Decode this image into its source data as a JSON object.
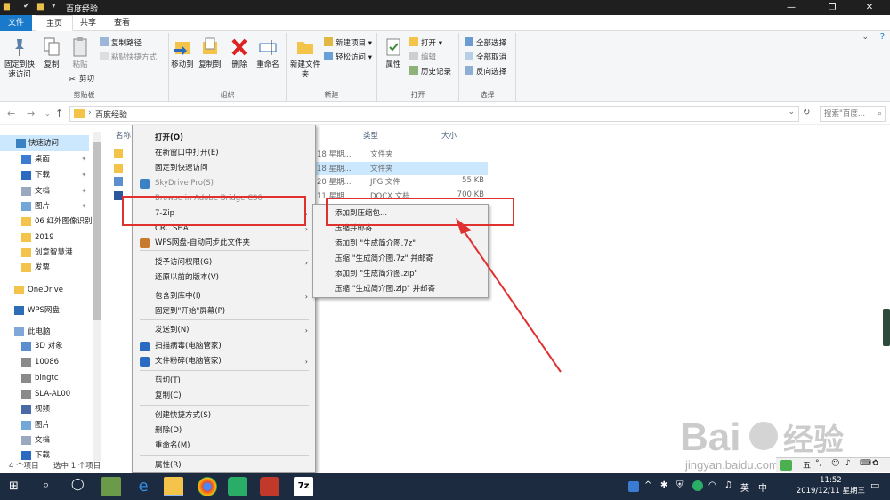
{
  "window": {
    "title": "百度经验"
  },
  "tabs": {
    "file": "文件",
    "home": "主页",
    "share": "共享",
    "view": "查看"
  },
  "ribbon": {
    "pin_label": "固定到快速访问",
    "copy_label": "复制",
    "paste_label": "粘贴",
    "copy_path": "复制路径",
    "paste_shortcut": "粘贴快捷方式",
    "cut": "剪切",
    "clipboard_group": "剪贴板",
    "move_to": "移动到",
    "copy_to": "复制到",
    "delete": "删除",
    "rename": "重命名",
    "organize_group": "组织",
    "new_folder": "新建文件夹",
    "new_item": "新建项目",
    "easy_access": "轻松访问",
    "new_group": "新建",
    "properties": "属性",
    "open": "打开",
    "edit": "编辑",
    "history": "历史记录",
    "open_group": "打开",
    "select_all": "全部选择",
    "select_none": "全部取消",
    "invert_select": "反向选择",
    "select_group": "选择"
  },
  "address": {
    "path": "百度经验",
    "search_placeholder": "搜索\"百度..."
  },
  "nav": {
    "items": [
      {
        "label": "快速访问"
      },
      {
        "label": "桌面"
      },
      {
        "label": "下载"
      },
      {
        "label": "文档"
      },
      {
        "label": "图片"
      },
      {
        "label": "06 红外图像识别"
      },
      {
        "label": "2019"
      },
      {
        "label": "创意智慧港"
      },
      {
        "label": "发票"
      },
      {
        "label": "OneDrive"
      },
      {
        "label": "WPS网盘"
      },
      {
        "label": "此电脑"
      },
      {
        "label": "3D 对象"
      },
      {
        "label": "10086"
      },
      {
        "label": "bingtc"
      },
      {
        "label": "SLA-AL00"
      },
      {
        "label": "视频"
      },
      {
        "label": "图片"
      },
      {
        "label": "文档"
      },
      {
        "label": "下载"
      }
    ]
  },
  "filelist": {
    "headers": {
      "name": "名称",
      "type": "类型",
      "size": "大小"
    },
    "rows": [
      {
        "date": "18 星期...",
        "type": "文件夹",
        "size": ""
      },
      {
        "date": "18 星期...",
        "type": "文件夹",
        "size": ""
      },
      {
        "date": "20 星期...",
        "type": "JPG 文件",
        "size": "55 KB"
      },
      {
        "date": "11 星期...",
        "type": "DOCX 文档",
        "size": "700 KB"
      }
    ]
  },
  "status": {
    "count": "4 个项目",
    "selected": "选中 1 个项目"
  },
  "context_menu": {
    "items": [
      "打开(O)",
      "在新窗口中打开(E)",
      "固定到快速访问",
      "SkyDrive Pro(S)",
      "Browse in Adobe Bridge CS6",
      "7-Zip",
      "CRC SHA",
      "WPS网盘-自动同步此文件夹",
      "授予访问权限(G)",
      "还原以前的版本(V)",
      "包含到库中(I)",
      "固定到\"开始\"屏幕(P)",
      "发送到(N)",
      "扫描病毒(电脑管家)",
      "文件粉碎(电脑管家)",
      "剪切(T)",
      "复制(C)",
      "创建快捷方式(S)",
      "删除(D)",
      "重命名(M)",
      "属性(R)"
    ]
  },
  "submenu": {
    "items": [
      "添加到压缩包...",
      "压缩并邮寄...",
      "添加到 \"生成简介图.7z\"",
      "压缩 \"生成简介图.7z\" 并邮寄",
      "添加到 \"生成简介图.zip\"",
      "压缩 \"生成简介图.zip\" 并邮寄"
    ]
  },
  "taskbar": {
    "time": "11:52",
    "date": "2019/12/11 星期三"
  },
  "ime": {
    "label": "五"
  },
  "watermark": {
    "text": "Bai 经验",
    "sub": "jingyan.baidu.com"
  },
  "colors": {
    "accent": "#1979ca",
    "highlight": "#e03131",
    "taskbar": "#1c2b3f"
  }
}
